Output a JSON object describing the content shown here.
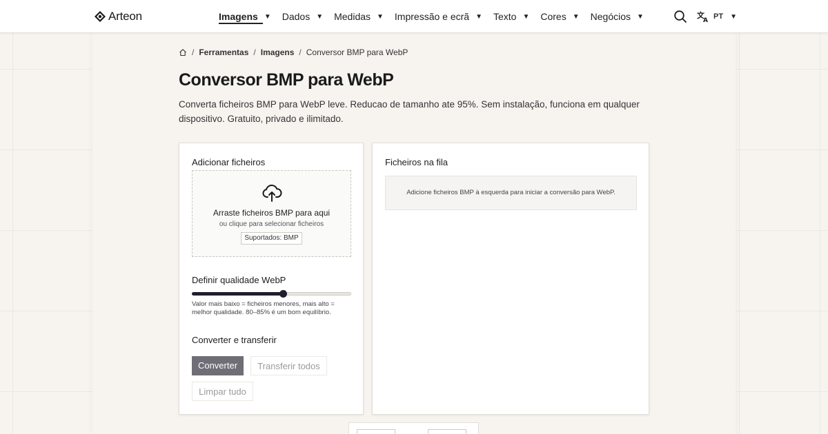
{
  "brand": {
    "name": "Arteon"
  },
  "nav": {
    "items": [
      {
        "label": "Imagens",
        "active": true
      },
      {
        "label": "Dados"
      },
      {
        "label": "Medidas"
      },
      {
        "label": "Impressão e ecrã"
      },
      {
        "label": "Texto"
      },
      {
        "label": "Cores"
      },
      {
        "label": "Negócios"
      }
    ],
    "caret": "▼",
    "language": "PT"
  },
  "breadcrumb": {
    "items": [
      "Ferramentas",
      "Imagens",
      "Conversor BMP para WebP"
    ],
    "separator": "/"
  },
  "page": {
    "title": "Conversor BMP para WebP",
    "description": "Converta ficheiros BMP para WebP leve. Reducao de tamanho ate 95%. Sem instalação, funciona em qualquer dispositivo. Gratuito, privado e ilimitado."
  },
  "upload": {
    "section_title": "Adicionar ficheiros",
    "drop_title": "Arraste ficheiros BMP para aqui",
    "drop_subtitle": "ou clique para selecionar ficheiros",
    "supported": "Suportados: BMP"
  },
  "quality": {
    "section_title": "Definir qualidade WebP",
    "slider_value_fraction": 0.57,
    "hint": "Valor mais baixo = ficheiros menores, mais alto = melhor qualidade. 80–85% é um bom equilíbrio."
  },
  "convert": {
    "section_title": "Converter e transferir",
    "convert_label": "Converter",
    "download_all_label": "Transferir todos",
    "clear_label": "Limpar tudo"
  },
  "queue": {
    "section_title": "Ficheiros na fila",
    "empty_message": "Adicione ficheiros BMP à esquerda para iniciar a conversão para WebP."
  },
  "colors": {
    "primary_button": "#6f6e77",
    "slider": "#1e1e2e",
    "page_background": "#f7f4f0"
  },
  "icons": [
    "brand-logo-icon",
    "search-icon",
    "translate-icon",
    "home-icon",
    "cloud-upload-icon"
  ]
}
